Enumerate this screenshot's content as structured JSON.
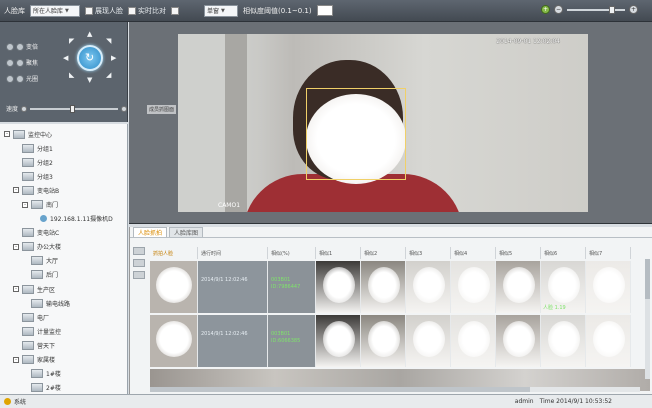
{
  "toolbar": {
    "face_lib_label": "人脸库",
    "face_lib_value": "所在人脸库",
    "checkbox1_label": "展现人脸",
    "checkbox2_label": "实时比对",
    "mode_value": "单窗",
    "threshold_label": "相似度阈值(0.1~0.1)"
  },
  "ptz": {
    "buttons": [
      {
        "label": "变倍"
      },
      {
        "label": "聚焦"
      },
      {
        "label": "光圈"
      }
    ],
    "speed_label": "速度"
  },
  "tree": {
    "items": [
      {
        "label": "监控中心",
        "level": 0,
        "expander": "-",
        "type": "folder"
      },
      {
        "label": "分组1",
        "level": 1,
        "expander": "",
        "type": "folder"
      },
      {
        "label": "分组2",
        "level": 1,
        "expander": "",
        "type": "folder"
      },
      {
        "label": "分组3",
        "level": 1,
        "expander": "",
        "type": "folder"
      },
      {
        "label": "变电站B",
        "level": 1,
        "expander": "-",
        "type": "folder"
      },
      {
        "label": "南门",
        "level": 2,
        "expander": "-",
        "type": "folder"
      },
      {
        "label": "192.168.1.11摄像机D",
        "level": 3,
        "expander": "",
        "type": "camera"
      },
      {
        "label": "变电站C",
        "level": 1,
        "expander": "",
        "type": "folder"
      },
      {
        "label": "办公大楼",
        "level": 1,
        "expander": "-",
        "type": "folder"
      },
      {
        "label": "大厅",
        "level": 2,
        "expander": "",
        "type": "folder"
      },
      {
        "label": "后门",
        "level": 2,
        "expander": "",
        "type": "folder"
      },
      {
        "label": "生产区",
        "level": 1,
        "expander": "-",
        "type": "folder"
      },
      {
        "label": "输电线路",
        "level": 2,
        "expander": "",
        "type": "folder"
      },
      {
        "label": "电厂",
        "level": 1,
        "expander": "",
        "type": "folder"
      },
      {
        "label": "计量监控",
        "level": 1,
        "expander": "",
        "type": "folder"
      },
      {
        "label": "营天下",
        "level": 1,
        "expander": "",
        "type": "folder"
      },
      {
        "label": "家属楼",
        "level": 1,
        "expander": "-",
        "type": "folder"
      },
      {
        "label": "1#楼",
        "level": 2,
        "expander": "",
        "type": "folder"
      },
      {
        "label": "2#楼",
        "level": 2,
        "expander": "",
        "type": "folder"
      }
    ]
  },
  "video": {
    "timestamp": "2014-09-01 12:02:04",
    "camera_label": "CAMO1",
    "overlay_tag": "成员抓图面"
  },
  "bottom": {
    "tabs": [
      {
        "label": "人脸抓拍",
        "active": true
      },
      {
        "label": "人脸库图",
        "active": false
      }
    ],
    "headers": [
      {
        "label": "抓拍人脸",
        "active": true
      },
      {
        "label": "通行时间",
        "active": false
      },
      {
        "label": "相似(%)",
        "active": false
      },
      {
        "label": "相似1",
        "active": false
      },
      {
        "label": "相似2",
        "active": false
      },
      {
        "label": "相似3",
        "active": false
      },
      {
        "label": "相似4",
        "active": false
      },
      {
        "label": "相似5",
        "active": false
      },
      {
        "label": "相似6",
        "active": false
      },
      {
        "label": "相似7",
        "active": false
      }
    ],
    "rows": [
      {
        "time": "2014/9/1 12:02:46",
        "id": "003B01\nID:7986447",
        "matches": [
          "",
          "",
          "",
          "",
          "",
          "人脸 1.19",
          ""
        ]
      },
      {
        "time": "2014/9/1 12:02:46",
        "id": "003B01\nID:6066385",
        "matches": [
          "",
          "",
          "",
          "",
          "",
          "",
          ""
        ]
      }
    ]
  },
  "status": {
    "left_label": "系统",
    "user": "admin",
    "time": "Time 2014/9/1 10:53:52"
  }
}
